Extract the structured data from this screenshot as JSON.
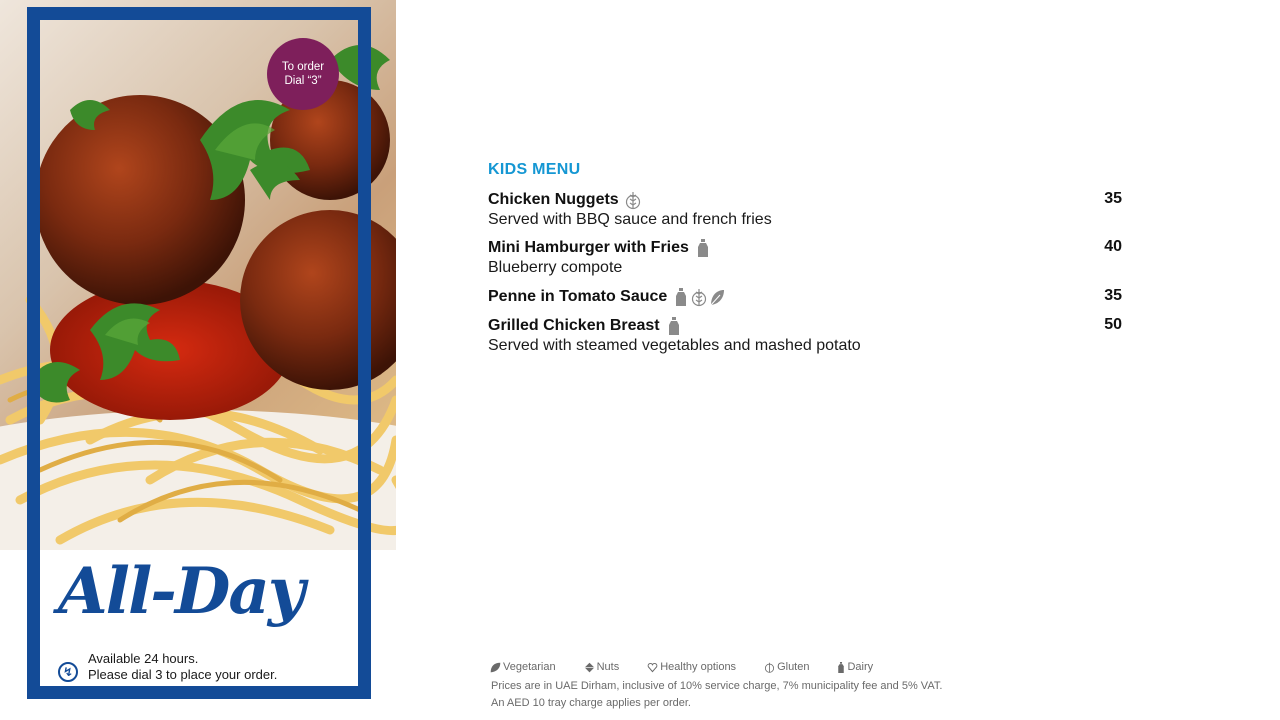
{
  "badge": {
    "line1": "To order",
    "line2": "Dial “3”"
  },
  "branding": {
    "title": "All-Day"
  },
  "availability": {
    "line1": "Available 24 hours.",
    "line2": "Please dial 3 to place your order."
  },
  "menu": {
    "title": "KIDS MENU",
    "items": [
      {
        "name": "Chicken Nuggets",
        "desc": "Served with BBQ sauce and french fries",
        "price": "35",
        "icons": [
          "gluten-icon"
        ]
      },
      {
        "name": "Mini Hamburger with Fries",
        "desc": "Blueberry compote",
        "price": "40",
        "icons": [
          "dairy-icon"
        ]
      },
      {
        "name": "Penne in Tomato Sauce",
        "desc": "",
        "price": "35",
        "icons": [
          "dairy-icon",
          "gluten-icon",
          "vegetarian-icon"
        ]
      },
      {
        "name": "Grilled Chicken Breast",
        "desc": "Served with steamed vegetables and mashed potato",
        "price": "50",
        "icons": [
          "dairy-icon"
        ]
      }
    ]
  },
  "legend": {
    "vegetarian": "Vegetarian",
    "nuts": "Nuts",
    "healthy": "Healthy options",
    "gluten": "Gluten",
    "dairy": "Dairy"
  },
  "footer": {
    "line1": "Prices are in UAE Dirham, inclusive of 10% service charge, 7% municipality fee and 5% VAT.",
    "line2": "An AED 10 tray charge applies per order."
  },
  "colors": {
    "frame": "#134b97",
    "badge": "#7e1f5b",
    "heading": "#1597d3",
    "legend": "#6a6a6a"
  }
}
